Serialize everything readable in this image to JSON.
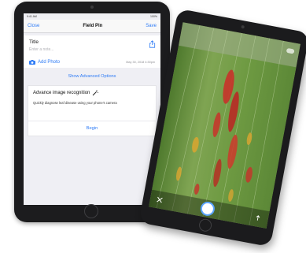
{
  "field_pin": {
    "status_time": "9:41 AM",
    "status_battery": "100%",
    "nav": {
      "close": "Close",
      "title": "Field Pin",
      "save": "Save"
    },
    "title_label": "Title",
    "notes_placeholder": "Enter a note...",
    "add_photo": "Add Photo",
    "date": "May 30, 2018 4:30pm",
    "show_advanced": "Show Advanced Options",
    "recognition": {
      "heading": "Advance image recognition",
      "description": "Quickly diagnose leaf disease using your phone's camera",
      "begin": "Begin"
    }
  },
  "camera_view": {
    "icons": [
      "close-icon",
      "shutter-button",
      "flip-icon"
    ],
    "accent": "#5aa3ff"
  },
  "colors": {
    "ios_blue": "#2f7cf6",
    "device_frame": "#1c1c1e",
    "leaf_green": "#6f9146",
    "disease_red": "#c8322a",
    "disease_yellow": "#d6a531"
  }
}
